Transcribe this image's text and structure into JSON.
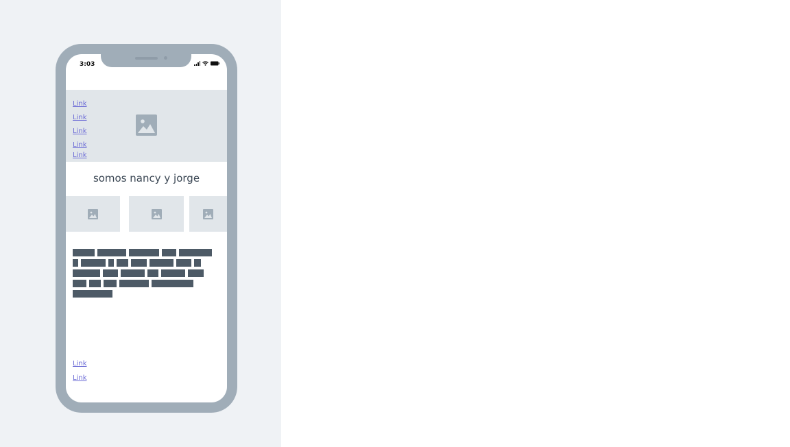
{
  "status_bar": {
    "time": "3:03"
  },
  "hero": {
    "links": [
      "Link",
      "Link",
      "Link",
      "Link",
      "Link"
    ]
  },
  "heading": "somos nancy y jorge",
  "footer": {
    "links": [
      "Link",
      "Link"
    ]
  },
  "icons": [
    "image-icon",
    "signal-icon",
    "wifi-icon",
    "battery-icon"
  ],
  "colors": {
    "frame": "#a0adb8",
    "placeholder": "#e1e6ea",
    "link": "#6b6bd6",
    "text_block": "#4d5a66",
    "background": "#eff2f5"
  }
}
